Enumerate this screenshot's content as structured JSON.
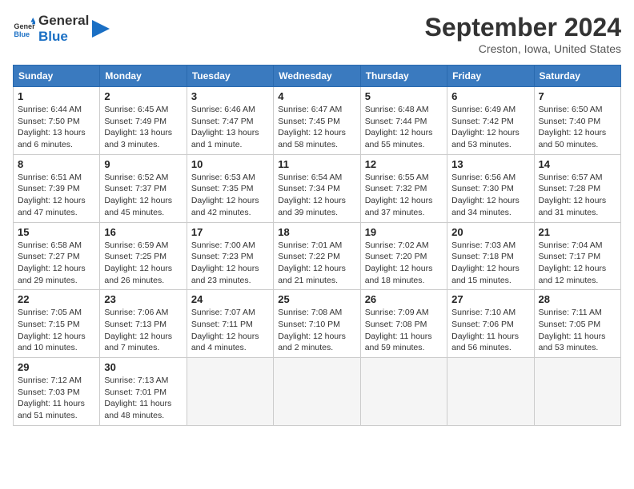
{
  "header": {
    "logo_line1": "General",
    "logo_line2": "Blue",
    "month": "September 2024",
    "location": "Creston, Iowa, United States"
  },
  "weekdays": [
    "Sunday",
    "Monday",
    "Tuesday",
    "Wednesday",
    "Thursday",
    "Friday",
    "Saturday"
  ],
  "weeks": [
    [
      {
        "day": "1",
        "info": "Sunrise: 6:44 AM\nSunset: 7:50 PM\nDaylight: 13 hours\nand 6 minutes."
      },
      {
        "day": "2",
        "info": "Sunrise: 6:45 AM\nSunset: 7:49 PM\nDaylight: 13 hours\nand 3 minutes."
      },
      {
        "day": "3",
        "info": "Sunrise: 6:46 AM\nSunset: 7:47 PM\nDaylight: 13 hours\nand 1 minute."
      },
      {
        "day": "4",
        "info": "Sunrise: 6:47 AM\nSunset: 7:45 PM\nDaylight: 12 hours\nand 58 minutes."
      },
      {
        "day": "5",
        "info": "Sunrise: 6:48 AM\nSunset: 7:44 PM\nDaylight: 12 hours\nand 55 minutes."
      },
      {
        "day": "6",
        "info": "Sunrise: 6:49 AM\nSunset: 7:42 PM\nDaylight: 12 hours\nand 53 minutes."
      },
      {
        "day": "7",
        "info": "Sunrise: 6:50 AM\nSunset: 7:40 PM\nDaylight: 12 hours\nand 50 minutes."
      }
    ],
    [
      {
        "day": "8",
        "info": "Sunrise: 6:51 AM\nSunset: 7:39 PM\nDaylight: 12 hours\nand 47 minutes."
      },
      {
        "day": "9",
        "info": "Sunrise: 6:52 AM\nSunset: 7:37 PM\nDaylight: 12 hours\nand 45 minutes."
      },
      {
        "day": "10",
        "info": "Sunrise: 6:53 AM\nSunset: 7:35 PM\nDaylight: 12 hours\nand 42 minutes."
      },
      {
        "day": "11",
        "info": "Sunrise: 6:54 AM\nSunset: 7:34 PM\nDaylight: 12 hours\nand 39 minutes."
      },
      {
        "day": "12",
        "info": "Sunrise: 6:55 AM\nSunset: 7:32 PM\nDaylight: 12 hours\nand 37 minutes."
      },
      {
        "day": "13",
        "info": "Sunrise: 6:56 AM\nSunset: 7:30 PM\nDaylight: 12 hours\nand 34 minutes."
      },
      {
        "day": "14",
        "info": "Sunrise: 6:57 AM\nSunset: 7:28 PM\nDaylight: 12 hours\nand 31 minutes."
      }
    ],
    [
      {
        "day": "15",
        "info": "Sunrise: 6:58 AM\nSunset: 7:27 PM\nDaylight: 12 hours\nand 29 minutes."
      },
      {
        "day": "16",
        "info": "Sunrise: 6:59 AM\nSunset: 7:25 PM\nDaylight: 12 hours\nand 26 minutes."
      },
      {
        "day": "17",
        "info": "Sunrise: 7:00 AM\nSunset: 7:23 PM\nDaylight: 12 hours\nand 23 minutes."
      },
      {
        "day": "18",
        "info": "Sunrise: 7:01 AM\nSunset: 7:22 PM\nDaylight: 12 hours\nand 21 minutes."
      },
      {
        "day": "19",
        "info": "Sunrise: 7:02 AM\nSunset: 7:20 PM\nDaylight: 12 hours\nand 18 minutes."
      },
      {
        "day": "20",
        "info": "Sunrise: 7:03 AM\nSunset: 7:18 PM\nDaylight: 12 hours\nand 15 minutes."
      },
      {
        "day": "21",
        "info": "Sunrise: 7:04 AM\nSunset: 7:17 PM\nDaylight: 12 hours\nand 12 minutes."
      }
    ],
    [
      {
        "day": "22",
        "info": "Sunrise: 7:05 AM\nSunset: 7:15 PM\nDaylight: 12 hours\nand 10 minutes."
      },
      {
        "day": "23",
        "info": "Sunrise: 7:06 AM\nSunset: 7:13 PM\nDaylight: 12 hours\nand 7 minutes."
      },
      {
        "day": "24",
        "info": "Sunrise: 7:07 AM\nSunset: 7:11 PM\nDaylight: 12 hours\nand 4 minutes."
      },
      {
        "day": "25",
        "info": "Sunrise: 7:08 AM\nSunset: 7:10 PM\nDaylight: 12 hours\nand 2 minutes."
      },
      {
        "day": "26",
        "info": "Sunrise: 7:09 AM\nSunset: 7:08 PM\nDaylight: 11 hours\nand 59 minutes."
      },
      {
        "day": "27",
        "info": "Sunrise: 7:10 AM\nSunset: 7:06 PM\nDaylight: 11 hours\nand 56 minutes."
      },
      {
        "day": "28",
        "info": "Sunrise: 7:11 AM\nSunset: 7:05 PM\nDaylight: 11 hours\nand 53 minutes."
      }
    ],
    [
      {
        "day": "29",
        "info": "Sunrise: 7:12 AM\nSunset: 7:03 PM\nDaylight: 11 hours\nand 51 minutes."
      },
      {
        "day": "30",
        "info": "Sunrise: 7:13 AM\nSunset: 7:01 PM\nDaylight: 11 hours\nand 48 minutes."
      },
      {
        "day": "",
        "info": ""
      },
      {
        "day": "",
        "info": ""
      },
      {
        "day": "",
        "info": ""
      },
      {
        "day": "",
        "info": ""
      },
      {
        "day": "",
        "info": ""
      }
    ]
  ]
}
